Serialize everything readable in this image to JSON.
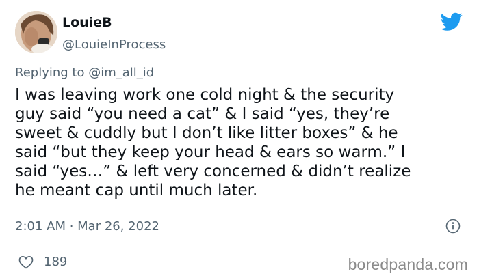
{
  "user": {
    "display_name": "LouieB",
    "handle": "@LouieInProcess"
  },
  "reply": {
    "prefix": "Replying to",
    "mention": "@im_all_id"
  },
  "tweet": {
    "lines": [
      "I was leaving work one cold night & the security",
      "guy said “you need a cat” & I said “yes, they’re",
      "sweet & cuddly but I don’t like litter boxes” & he",
      "said “but they keep your head & ears so warm.” I",
      "said “yes…” & left very concerned & didn’t realize",
      "he meant cap until much later."
    ]
  },
  "meta": {
    "timestamp": "2:01 AM · Mar 26, 2022"
  },
  "actions": {
    "like_count": "189"
  },
  "watermark": "boredpanda.com",
  "colors": {
    "twitter_blue": "#1d9bf0",
    "text": "#0f1419",
    "secondary": "#536471",
    "divider": "#cfd9de"
  },
  "icons": [
    "avatar-photo",
    "twitter-bird-icon",
    "info-icon",
    "heart-icon"
  ]
}
